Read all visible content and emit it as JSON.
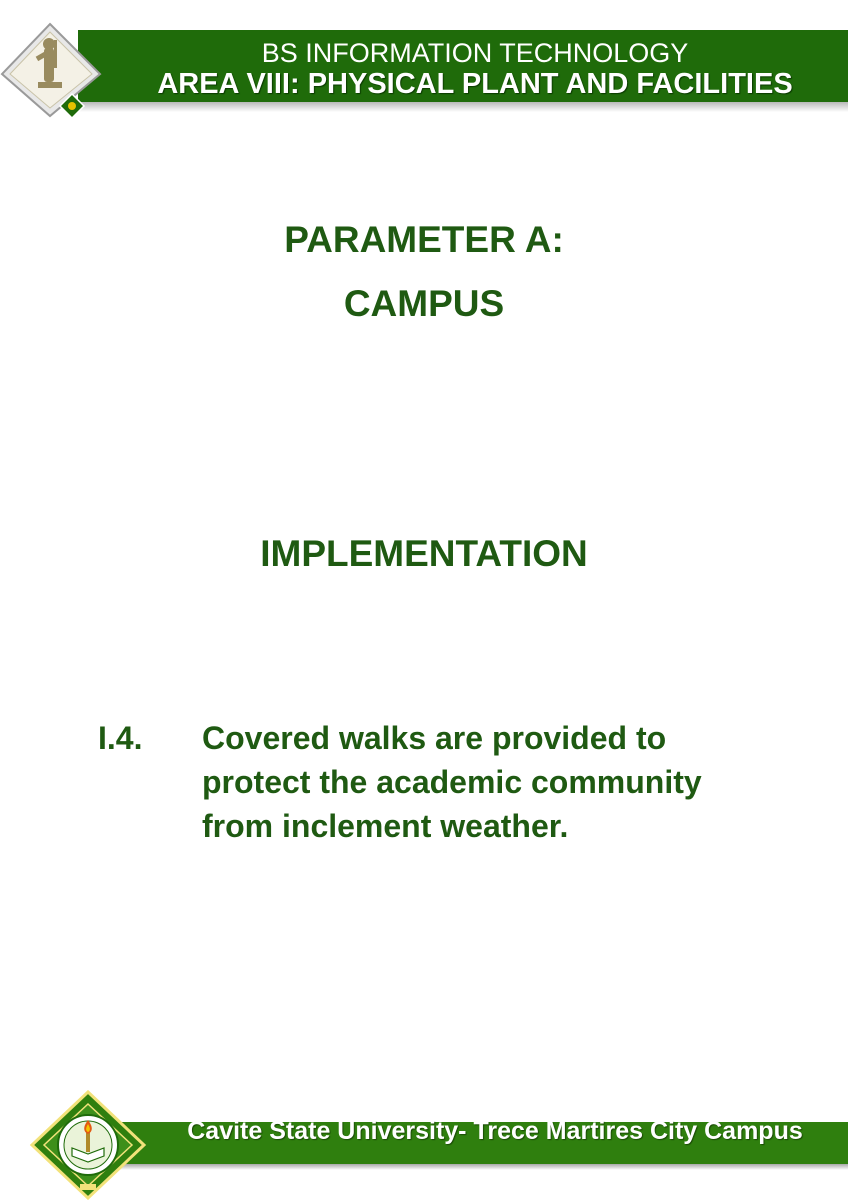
{
  "header": {
    "program": "BS INFORMATION TECHNOLOGY",
    "area": "AREA VIII: PHYSICAL PLANT AND FACILITIES"
  },
  "parameter": {
    "label": "PARAMETER A:",
    "name": "CAMPUS"
  },
  "section": {
    "title": "IMPLEMENTATION"
  },
  "item": {
    "number": "I.4.",
    "text": "Covered walks are provided to protect the academic community from inclement weather."
  },
  "footer": {
    "campus": "Cavite State University- Trece Martires City Campus"
  },
  "colors": {
    "header_green": "#1f6b0a",
    "footer_green": "#2f7f0e",
    "text_green": "#1f5a12"
  }
}
